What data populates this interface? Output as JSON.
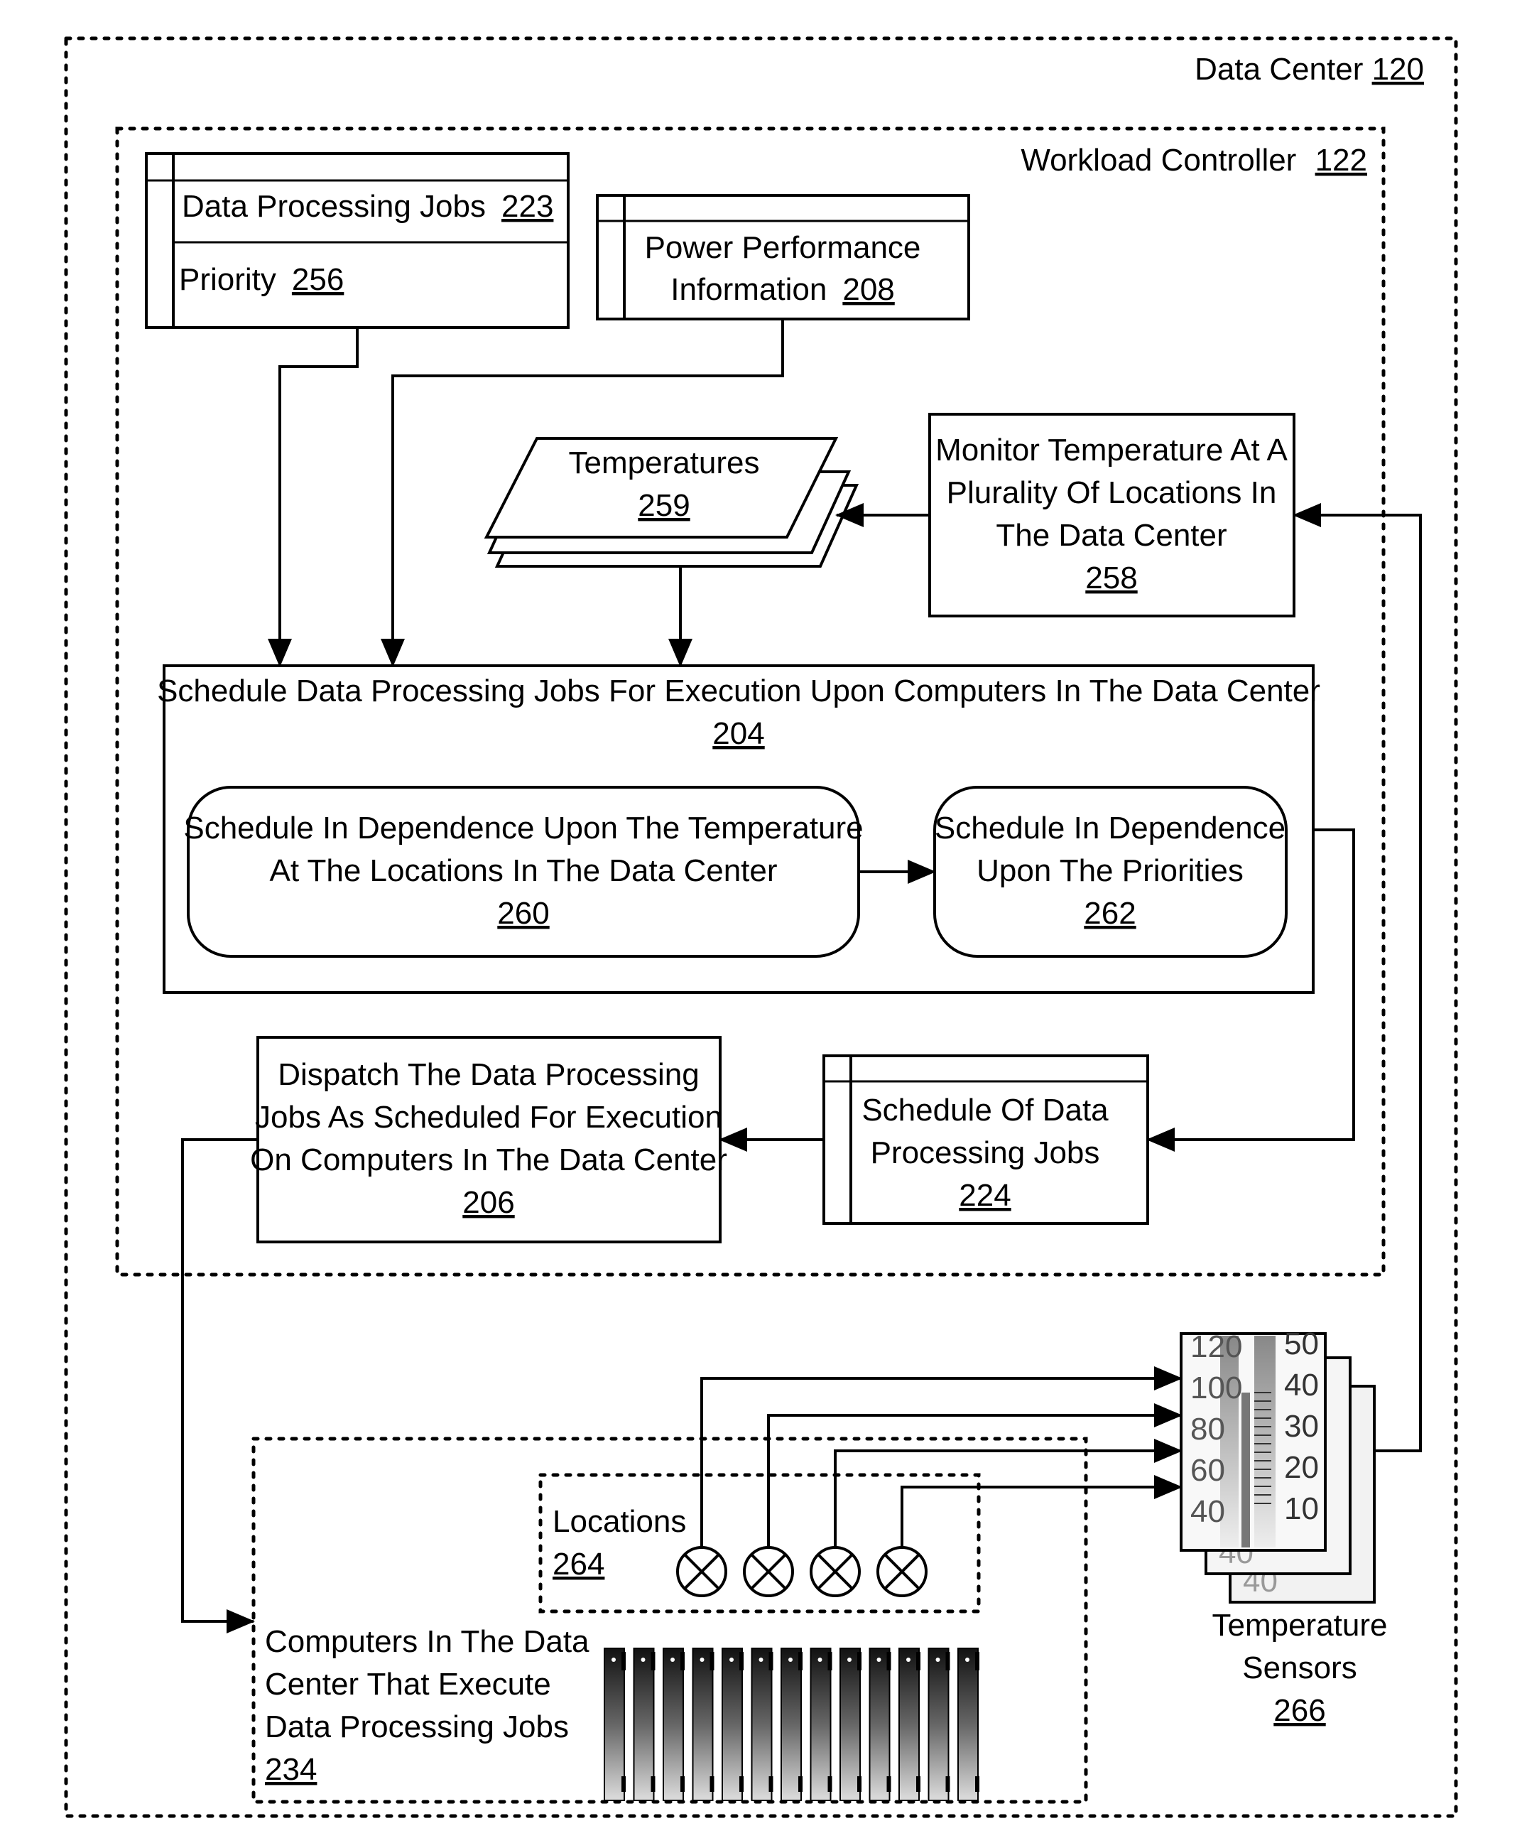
{
  "data_center": {
    "label": "Data Center",
    "ref": "120"
  },
  "workload_controller": {
    "label": "Workload Controller",
    "ref": "122"
  },
  "data_processing_jobs": {
    "label": "Data Processing Jobs",
    "ref": "223",
    "field_label": "Priority",
    "field_ref": "256"
  },
  "power_performance": {
    "line1": "Power Performance",
    "line2": "Information",
    "ref": "208"
  },
  "temperatures": {
    "label": "Temperatures",
    "ref": "259"
  },
  "monitor": {
    "line1": "Monitor Temperature At A",
    "line2": "Plurality Of Locations In",
    "line3": "The Data Center",
    "ref": "258"
  },
  "schedule": {
    "label": "Schedule Data Processing Jobs For Execution Upon Computers In The Data Center",
    "ref": "204"
  },
  "schedule_temperature": {
    "line1": "Schedule In Dependence Upon The Temperature",
    "line2": "At The Locations In The Data Center",
    "ref": "260"
  },
  "schedule_priorities": {
    "line1": "Schedule In Dependence",
    "line2": "Upon The Priorities",
    "ref": "262"
  },
  "dispatch": {
    "line1": "Dispatch The Data Processing",
    "line2": "Jobs As Scheduled For Execution",
    "line3": "On Computers In The Data Center",
    "ref": "206"
  },
  "schedule_of_jobs": {
    "line1": "Schedule Of Data",
    "line2": "Processing Jobs",
    "ref": "224"
  },
  "locations": {
    "label": "Locations",
    "ref": "264",
    "count": 4
  },
  "computers": {
    "line1": "Computers In The Data",
    "line2": "Center That Execute",
    "line3": "Data Processing Jobs",
    "ref": "234",
    "server_count": 13
  },
  "temperature_sensors": {
    "line1": "Temperature",
    "line2": "Sensors",
    "ref": "266",
    "scale_left": [
      "120",
      "100",
      "80",
      "60",
      "40"
    ],
    "scale_right": [
      "50",
      "40",
      "30",
      "20",
      "10"
    ],
    "back_label": "40"
  }
}
